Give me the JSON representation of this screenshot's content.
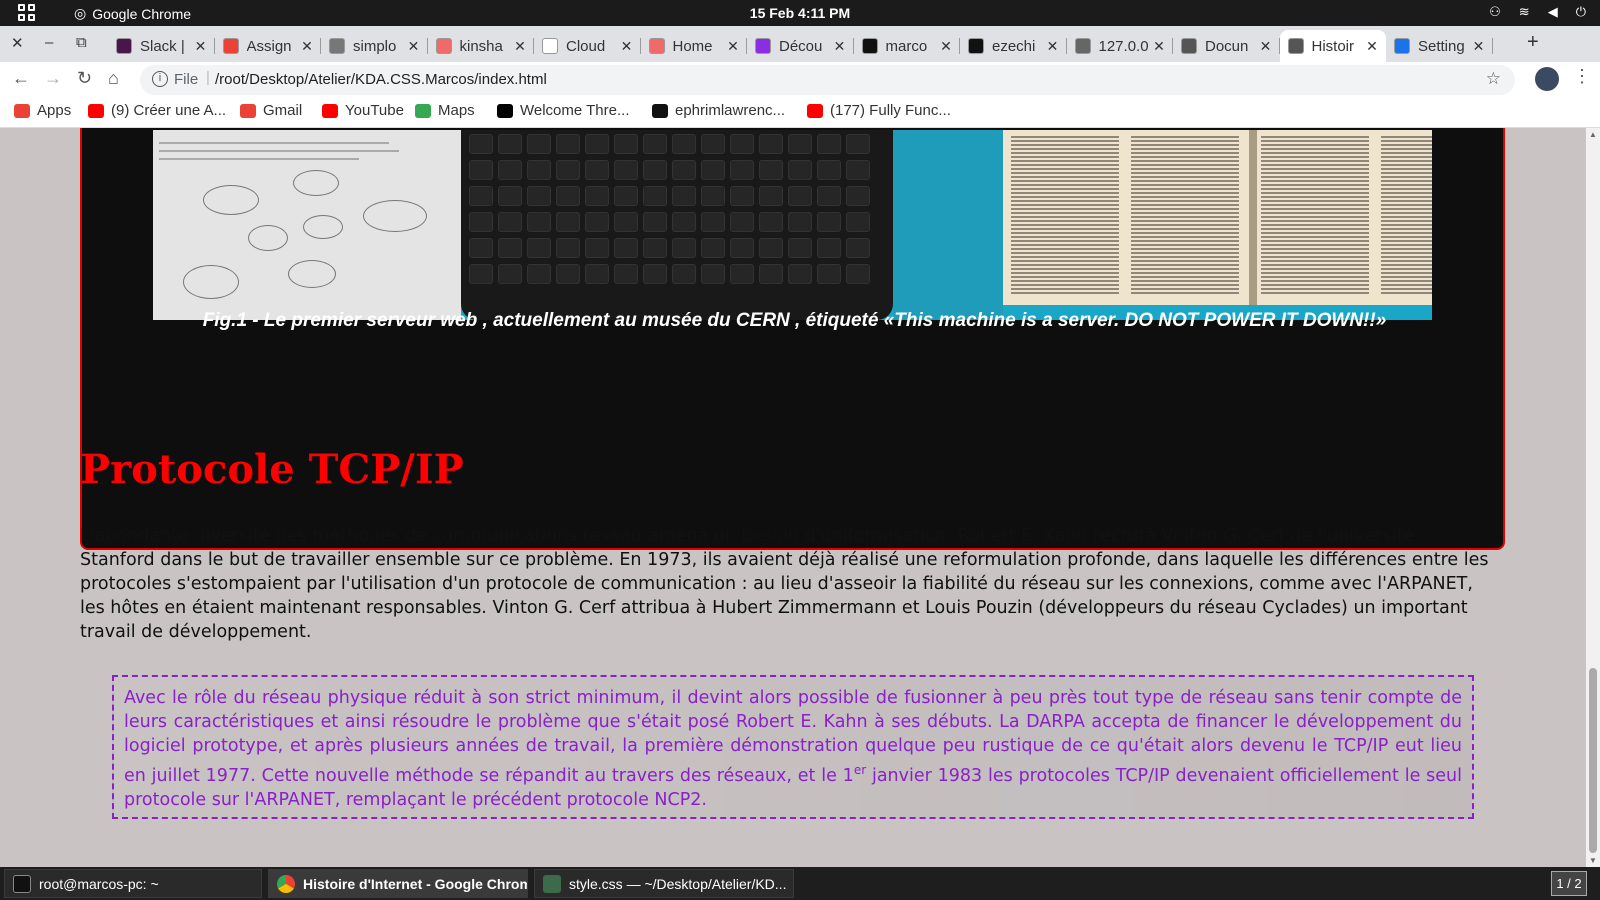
{
  "system_bar": {
    "app_name": "Google Chrome",
    "clock": "15 Feb  4:11 PM"
  },
  "tabs": [
    {
      "title": "Slack |",
      "color": "#4a154b"
    },
    {
      "title": "Assign",
      "color": "#ea4335"
    },
    {
      "title": "simplo",
      "color": "#777777"
    },
    {
      "title": "kinsha",
      "color": "#f06a6a"
    },
    {
      "title": "Cloud",
      "color": "#ffffff"
    },
    {
      "title": "Home",
      "color": "#f06a6a"
    },
    {
      "title": "Décou",
      "color": "#8b2de2"
    },
    {
      "title": "marco",
      "color": "#111111"
    },
    {
      "title": "ezechi",
      "color": "#111111"
    },
    {
      "title": "127.0.0",
      "color": "#666666"
    },
    {
      "title": "Docun",
      "color": "#555555"
    },
    {
      "title": "Histoir",
      "color": "#555555",
      "active": true
    },
    {
      "title": "Setting",
      "color": "#1a73e8"
    }
  ],
  "toolbar": {
    "scheme": "File",
    "url": "/root/Desktop/Atelier/KDA.CSS.Marcos/index.html"
  },
  "bookmarks": [
    {
      "label": "Apps",
      "color": "#ea4335"
    },
    {
      "label": "(9) Créer une A...",
      "color": "#ff0000"
    },
    {
      "label": "Gmail",
      "color": "#ea4335"
    },
    {
      "label": "YouTube",
      "color": "#ff0000"
    },
    {
      "label": "Maps",
      "color": "#34a853"
    },
    {
      "label": "Welcome Thre...",
      "color": "#000000"
    },
    {
      "label": "ephrimlawrenc...",
      "color": "#111111"
    },
    {
      "label": "(177) Fully Func...",
      "color": "#ff0000"
    }
  ],
  "page": {
    "figure_caption": "Fig.1 - Le premier serveur web , actuellement au musée du CERN , étiqueté «This machine is a server. DO NOT POWER IT DOWN!!»",
    "section_title": "Protocole TCP/IP",
    "paragraph": "L'abondante diversité des méthodes de communications réseau amena un besoin d'uniformisation. Robert E. Kahn recruta Vinton G. Cerf de l'université Stanford dans le but de travailler ensemble sur ce problème. En 1973, ils avaient déjà réalisé une reformulation profonde, dans laquelle les différences entre les protocoles s'estompaient par l'utilisation d'un protocole de communication : au lieu d'asseoir la fiabilité du réseau sur les connexions, comme avec l'ARPANET, les hôtes en étaient maintenant responsables. Vinton G. Cerf attribua à Hubert Zimmermann et Louis Pouzin (développeurs du réseau Cyclades) un important travail de développement.",
    "quote_before": "Avec le rôle du réseau physique réduit à son strict minimum, il devint alors possible de fusionner à peu près tout type de réseau sans tenir compte de leurs caractéristiques et ainsi résoudre le problème que s'était posé Robert E. Kahn à ses débuts. La DARPA accepta de financer le développement du logiciel prototype, et après plusieurs années de travail, la première démonstration quelque peu rustique de ce qu'était alors devenu le TCP/IP eut lieu en juillet 1977. Cette nouvelle méthode se répandit au travers des réseaux, et le 1",
    "quote_sup": "er",
    "quote_after": " janvier 1983 les protocoles TCP/IP devenaient officiellement le seul protocole sur l'ARPANET, remplaçant le précédent protocole NCP2.",
    "title_color": "#ff0000",
    "quote_color": "#8a20c8"
  },
  "taskbar": {
    "items": [
      {
        "label": "root@marcos-pc: ~"
      },
      {
        "label": "Histoire d'Internet - Google Chrome",
        "active": true
      },
      {
        "label": "style.css — ~/Desktop/Atelier/KD..."
      }
    ],
    "pager": "1 / 2"
  }
}
